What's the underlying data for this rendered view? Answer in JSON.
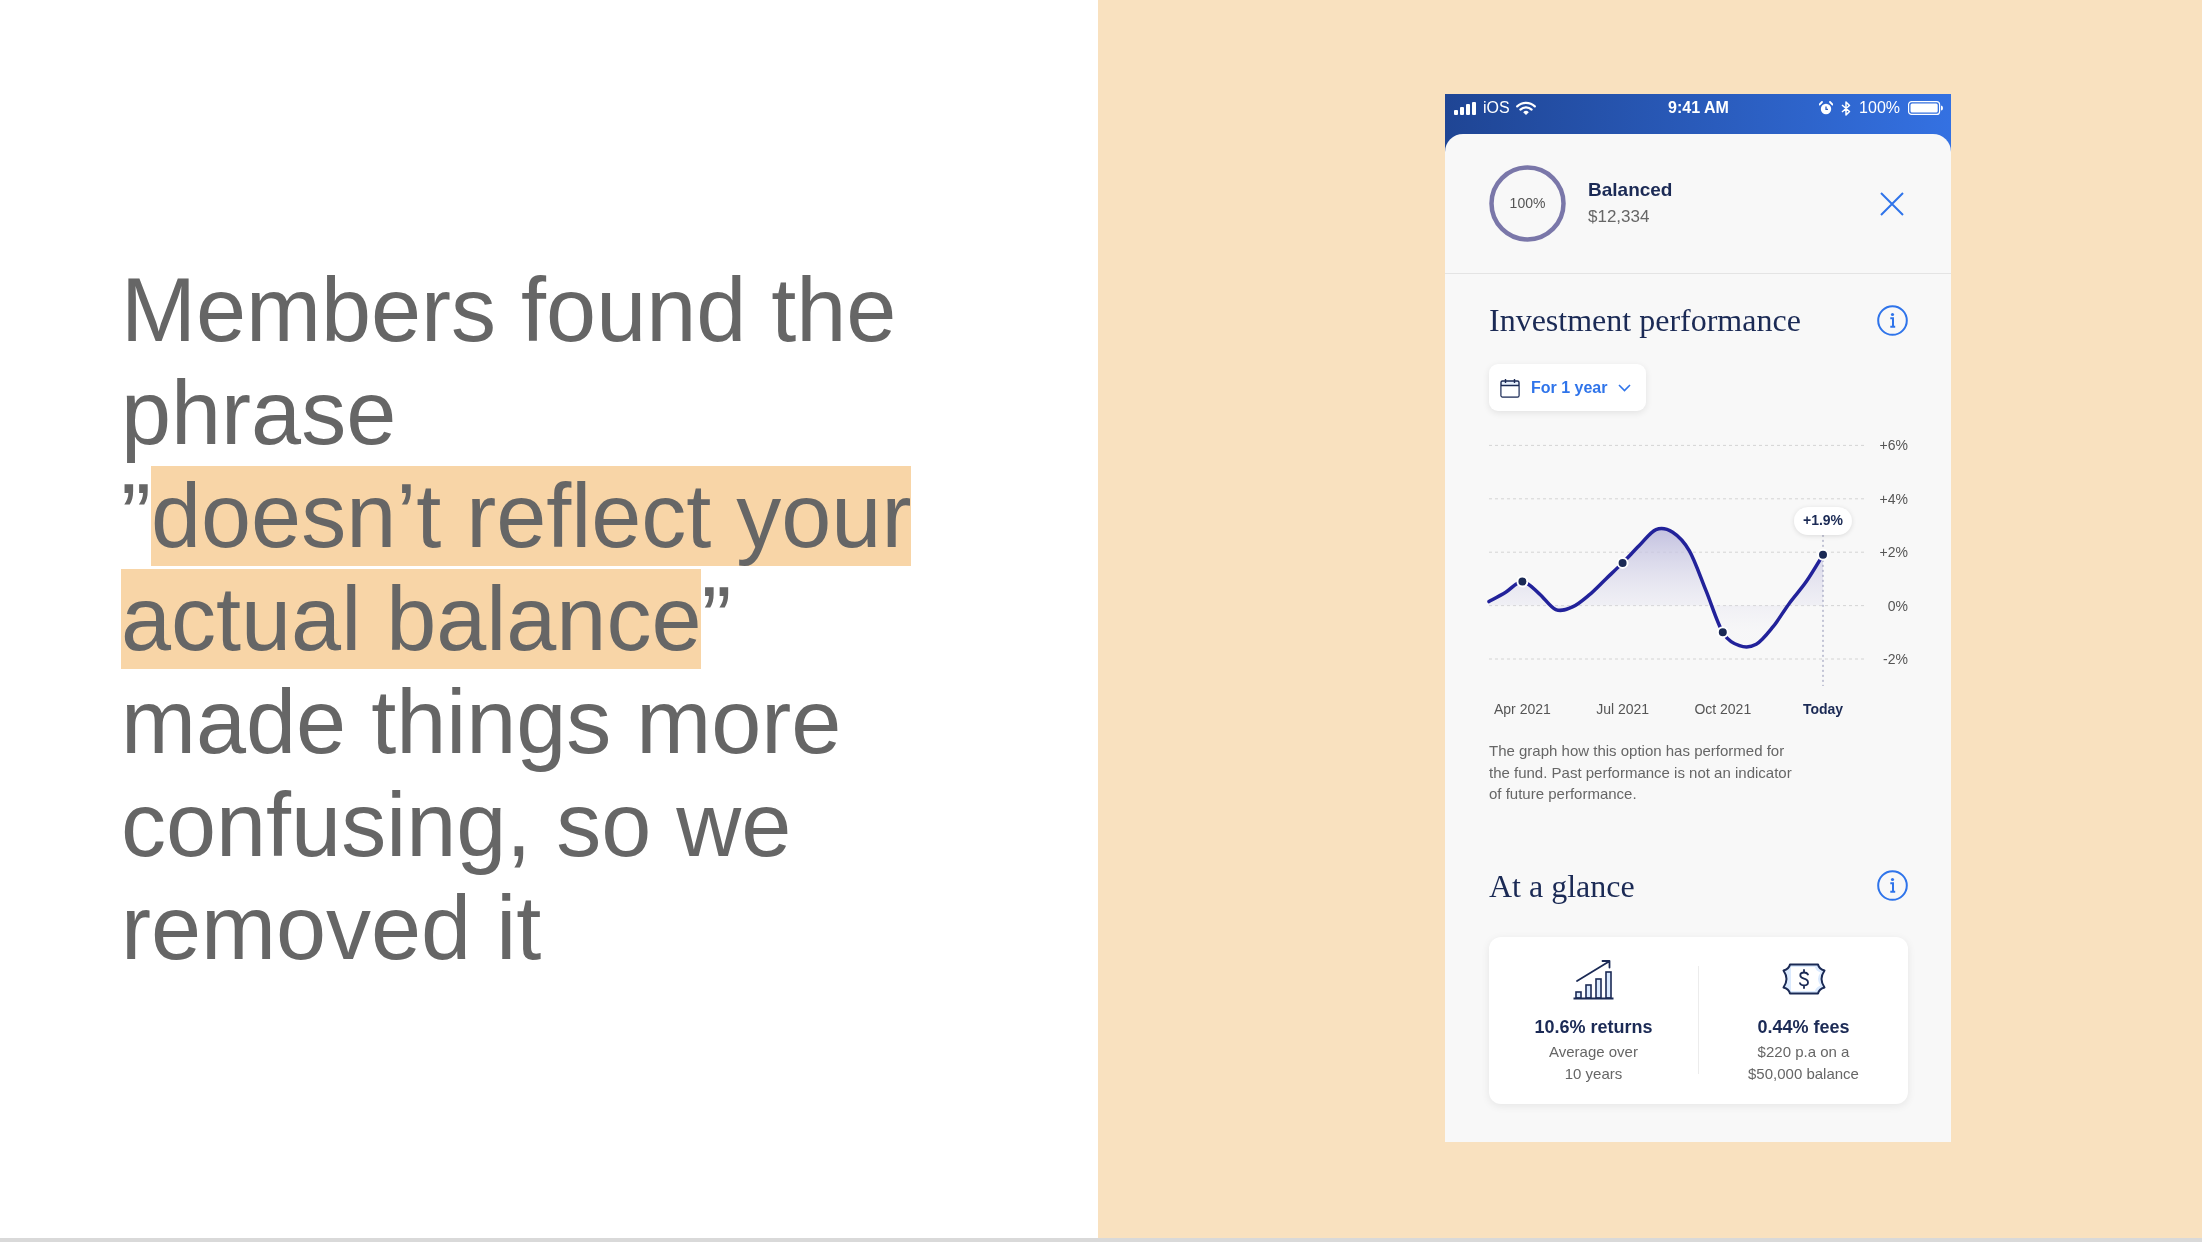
{
  "headline": {
    "parts": [
      {
        "text": "Members found the phrase\n”",
        "highlighted": false
      },
      {
        "text": "doesn’t reflect your actual balance",
        "highlighted": true
      },
      {
        "text": "”\nmade things more confusing, so we removed it",
        "highlighted": false
      }
    ]
  },
  "phone": {
    "status_bar": {
      "carrier": "iOS",
      "time": "9:41 AM",
      "battery": "100%"
    },
    "holding": {
      "allocation": "100%",
      "name": "Balanced",
      "balance": "$12,334"
    },
    "performance": {
      "title": "Investment performance",
      "period_select": {
        "value": "For 1 year"
      },
      "chart_data": {
        "type": "area",
        "categories": [
          null,
          null,
          "Apr 2021",
          null,
          null,
          null,
          null,
          null,
          "Jul 2021",
          null,
          null,
          null,
          null,
          null,
          "Oct 2021",
          null,
          null,
          null,
          null,
          null,
          "Today"
        ],
        "series": [
          {
            "color": "#22229a",
            "values": [
              0.15,
              0.5,
              0.9,
              0.45,
              -0.15,
              -0.05,
              0.4,
              1.0,
              1.6,
              2.25,
              2.85,
              2.75,
              2.05,
              0.55,
              -1.0,
              -1.5,
              -1.45,
              -0.8,
              0.1,
              0.9,
              1.9
            ]
          }
        ],
        "ylim": [
          -2,
          6
        ],
        "yticks": [
          {
            "value": 6,
            "label": "+6%"
          },
          {
            "value": 4,
            "label": "+4%"
          },
          {
            "value": 2,
            "label": "+2%"
          },
          {
            "value": 0,
            "label": "0%"
          },
          {
            "value": -2,
            "label": "-2%"
          }
        ],
        "grid": true,
        "annotations": [
          {
            "x": "Today",
            "y": 1.9,
            "text": "+1.9%"
          }
        ]
      },
      "disclaimer": "The graph how this option has performed for the fund. Past performance is not an indicator of future performance."
    },
    "at_a_glance": {
      "title": "At a glance",
      "stats": [
        {
          "kind": "returns",
          "value": "10.6% returns",
          "description": "Average over 10 years"
        },
        {
          "kind": "fees",
          "value": "0.44% fees",
          "description": "$220 p.a on a $50,000 balance"
        }
      ]
    }
  }
}
